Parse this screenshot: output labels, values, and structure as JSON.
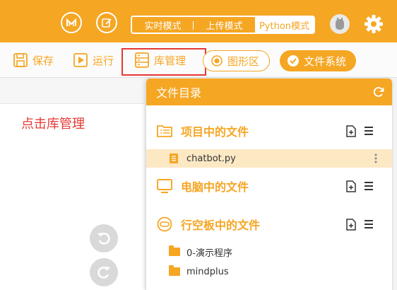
{
  "topbar": {
    "modes": [
      {
        "label": "实时模式",
        "active": false
      },
      {
        "label": "上传模式",
        "active": false
      },
      {
        "label": "Python模式",
        "active": true
      }
    ],
    "accent_color": "#f5a623"
  },
  "toolbar": {
    "save_label": "保存",
    "run_label": "运行",
    "library_label": "库管理",
    "graphics_label": "图形区",
    "filesystem_label": "文件系统"
  },
  "editor": {
    "annotation": "点击库管理",
    "annotation_color": "#e53935"
  },
  "panel": {
    "title": "文件目录",
    "sections": [
      {
        "title": "项目中的文件",
        "icon": "folder-list-icon"
      },
      {
        "title": "电脑中的文件",
        "icon": "monitor-icon"
      },
      {
        "title": "行空板中的文件",
        "icon": "board-icon"
      }
    ],
    "project_files": [
      {
        "name": "chatbot.py",
        "selected": true
      }
    ],
    "board_files": [
      {
        "name": "0-演示程序",
        "type": "folder"
      },
      {
        "name": "mindplus",
        "type": "folder"
      }
    ]
  }
}
